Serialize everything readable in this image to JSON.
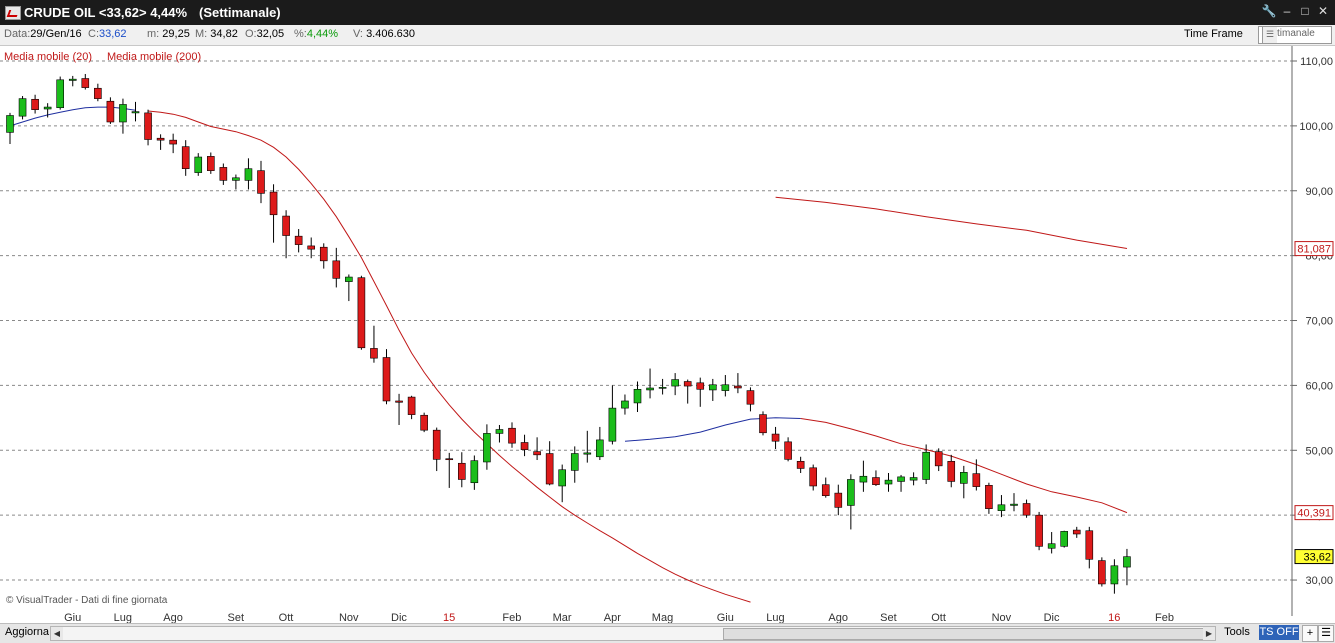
{
  "window": {
    "title": "CRUDE OIL <33,62> 4,44%",
    "timeframe_label": "(Settimanale)"
  },
  "infobar": {
    "date_label": "Data:",
    "date": "29/Gen/16",
    "close_label": "C:",
    "close": "33,62",
    "min_label": "m:",
    "min": "29,25",
    "max_label": "M:",
    "max": "34,82",
    "open_label": "O:",
    "open": "32,05",
    "pct_label": "%:",
    "pct": "4,44%",
    "vol_label": "V:",
    "vol": "3.406.630",
    "timeframe_label": "Time Frame",
    "timeframe_value": "Settimanale"
  },
  "colors": {
    "up": "#1bbd1b",
    "down": "#dd1a1a",
    "ma20": "#1f2fa0",
    "ma200": "#c01818",
    "grid": "#8a8a8a",
    "tag_bg": "#ffff33"
  },
  "footer": {
    "watermark": "© VisualTrader - Dati di fine giornata",
    "aggiorna": "Aggiorna",
    "tools": "Tools",
    "ts": "TS OFF",
    "plus": "+"
  },
  "chart_data": {
    "type": "candlestick",
    "legend": [
      "Media mobile (20)",
      "Media mobile (200)"
    ],
    "ylim": [
      26,
      110
    ],
    "yticks": [
      {
        "v": 110,
        "label": "110,00"
      },
      {
        "v": 100,
        "label": "100,00"
      },
      {
        "v": 90,
        "label": "90,00"
      },
      {
        "v": 80,
        "label": "80,00"
      },
      {
        "v": 70,
        "label": "70,00"
      },
      {
        "v": 60,
        "label": "60,00"
      },
      {
        "v": 50,
        "label": "50,00"
      },
      {
        "v": 40,
        "label": "40,00"
      },
      {
        "v": 30,
        "label": "30,00"
      }
    ],
    "xticks": [
      {
        "i": 3,
        "label": "Giu"
      },
      {
        "i": 7,
        "label": "Lug"
      },
      {
        "i": 11,
        "label": "Ago"
      },
      {
        "i": 16,
        "label": "Set"
      },
      {
        "i": 20,
        "label": "Ott"
      },
      {
        "i": 25,
        "label": "Nov"
      },
      {
        "i": 29,
        "label": "Dic"
      },
      {
        "i": 33,
        "label": "15",
        "highlight": true
      },
      {
        "i": 38,
        "label": "Feb"
      },
      {
        "i": 42,
        "label": "Mar"
      },
      {
        "i": 46,
        "label": "Apr"
      },
      {
        "i": 50,
        "label": "Mag"
      },
      {
        "i": 55,
        "label": "Giu"
      },
      {
        "i": 59,
        "label": "Lug"
      },
      {
        "i": 64,
        "label": "Ago"
      },
      {
        "i": 68,
        "label": "Set"
      },
      {
        "i": 72,
        "label": "Ott"
      },
      {
        "i": 77,
        "label": "Nov"
      },
      {
        "i": 81,
        "label": "Dic"
      },
      {
        "i": 86,
        "label": "16",
        "highlight": true
      },
      {
        "i": 90,
        "label": "Feb"
      }
    ],
    "price_tags": [
      {
        "v": 81.087,
        "label": "81,087",
        "style": "ma200"
      },
      {
        "v": 40.391,
        "label": "40,391",
        "style": "ma200"
      },
      {
        "v": 33.62,
        "label": "33,62",
        "style": "last"
      }
    ],
    "candles": [
      [
        99.0,
        102.0,
        97.2,
        101.6
      ],
      [
        101.5,
        104.6,
        101.0,
        104.2
      ],
      [
        104.1,
        104.8,
        101.9,
        102.5
      ],
      [
        102.6,
        103.5,
        101.3,
        102.9
      ],
      [
        102.8,
        107.6,
        102.5,
        107.1
      ],
      [
        107.0,
        107.7,
        106.1,
        107.2
      ],
      [
        107.3,
        108.0,
        105.6,
        105.9
      ],
      [
        105.8,
        106.5,
        103.8,
        104.2
      ],
      [
        103.8,
        104.4,
        100.3,
        100.6
      ],
      [
        100.6,
        104.2,
        98.8,
        103.3
      ],
      [
        102.0,
        103.7,
        100.7,
        102.2
      ],
      [
        102.0,
        102.5,
        97.0,
        97.9
      ],
      [
        98.1,
        98.7,
        96.3,
        97.8
      ],
      [
        97.8,
        98.8,
        95.8,
        97.2
      ],
      [
        96.8,
        97.8,
        92.3,
        93.4
      ],
      [
        92.8,
        95.8,
        92.3,
        95.2
      ],
      [
        95.3,
        95.9,
        92.6,
        93.1
      ],
      [
        93.6,
        94.2,
        90.9,
        91.6
      ],
      [
        91.6,
        92.5,
        90.2,
        92.0
      ],
      [
        91.6,
        95.0,
        90.2,
        93.4
      ],
      [
        93.1,
        94.6,
        88.1,
        89.6
      ],
      [
        89.8,
        91.0,
        82.0,
        86.3
      ],
      [
        86.1,
        87.0,
        79.6,
        83.1
      ],
      [
        83.0,
        84.1,
        80.5,
        81.7
      ],
      [
        81.5,
        82.8,
        79.6,
        81.0
      ],
      [
        81.3,
        81.9,
        78.0,
        79.2
      ],
      [
        79.2,
        81.2,
        75.1,
        76.5
      ],
      [
        76.0,
        77.1,
        73.0,
        76.7
      ],
      [
        76.6,
        76.9,
        65.5,
        65.8
      ],
      [
        65.7,
        69.2,
        63.5,
        64.2
      ],
      [
        64.3,
        65.6,
        57.1,
        57.6
      ],
      [
        57.6,
        58.7,
        53.9,
        57.4
      ],
      [
        58.2,
        58.4,
        54.8,
        55.5
      ],
      [
        55.4,
        55.8,
        52.8,
        53.1
      ],
      [
        53.1,
        53.5,
        46.8,
        48.6
      ],
      [
        48.7,
        49.6,
        44.2,
        48.6
      ],
      [
        48.0,
        49.7,
        44.3,
        45.5
      ],
      [
        45.0,
        49.2,
        43.9,
        48.4
      ],
      [
        48.2,
        54.0,
        47.0,
        52.6
      ],
      [
        52.6,
        53.9,
        51.2,
        53.2
      ],
      [
        53.4,
        54.3,
        50.4,
        51.1
      ],
      [
        51.2,
        52.4,
        49.1,
        50.1
      ],
      [
        49.8,
        52.0,
        48.5,
        49.3
      ],
      [
        49.5,
        51.4,
        44.6,
        44.8
      ],
      [
        44.5,
        47.8,
        42.0,
        47.0
      ],
      [
        46.9,
        50.6,
        45.0,
        49.5
      ],
      [
        49.4,
        53.0,
        48.1,
        49.6
      ],
      [
        49.0,
        53.6,
        48.5,
        51.6
      ],
      [
        51.4,
        60.0,
        50.9,
        56.5
      ],
      [
        56.5,
        58.6,
        55.5,
        57.6
      ],
      [
        57.3,
        60.6,
        55.9,
        59.4
      ],
      [
        59.3,
        62.6,
        58.0,
        59.6
      ],
      [
        59.7,
        61.0,
        58.6,
        59.7
      ],
      [
        59.9,
        61.9,
        58.5,
        60.9
      ],
      [
        60.6,
        60.9,
        57.2,
        59.9
      ],
      [
        60.4,
        61.2,
        56.7,
        59.4
      ],
      [
        59.3,
        61.0,
        57.6,
        60.1
      ],
      [
        59.2,
        61.6,
        58.3,
        60.1
      ],
      [
        59.9,
        61.9,
        58.8,
        59.6
      ],
      [
        59.2,
        59.7,
        56.0,
        57.1
      ],
      [
        55.5,
        56.0,
        52.3,
        52.7
      ],
      [
        52.5,
        53.6,
        50.2,
        51.4
      ],
      [
        51.3,
        52.0,
        48.3,
        48.6
      ],
      [
        48.3,
        49.0,
        46.5,
        47.2
      ],
      [
        47.3,
        47.8,
        43.8,
        44.5
      ],
      [
        44.7,
        45.8,
        42.7,
        43.0
      ],
      [
        43.4,
        44.7,
        40.0,
        41.2
      ],
      [
        41.5,
        46.3,
        37.8,
        45.5
      ],
      [
        45.1,
        48.4,
        43.6,
        46.0
      ],
      [
        45.8,
        46.9,
        44.5,
        44.7
      ],
      [
        44.8,
        46.5,
        43.6,
        45.4
      ],
      [
        45.2,
        46.2,
        43.6,
        45.9
      ],
      [
        45.4,
        46.6,
        44.6,
        45.8
      ],
      [
        45.5,
        50.9,
        44.8,
        49.7
      ],
      [
        49.8,
        50.3,
        46.8,
        47.6
      ],
      [
        48.3,
        49.3,
        44.3,
        45.2
      ],
      [
        44.9,
        47.6,
        42.6,
        46.6
      ],
      [
        46.4,
        48.6,
        43.8,
        44.4
      ],
      [
        44.6,
        45.0,
        40.2,
        41.0
      ],
      [
        40.7,
        43.1,
        39.7,
        41.6
      ],
      [
        41.5,
        43.4,
        40.6,
        41.7
      ],
      [
        41.8,
        42.4,
        39.6,
        40.0
      ],
      [
        40.0,
        40.5,
        34.6,
        35.2
      ],
      [
        34.9,
        37.4,
        34.1,
        35.6
      ],
      [
        35.2,
        37.6,
        35.0,
        37.5
      ],
      [
        37.7,
        38.2,
        36.5,
        37.1
      ],
      [
        37.6,
        38.2,
        31.8,
        33.2
      ],
      [
        33.0,
        33.5,
        29.0,
        29.4
      ],
      [
        29.4,
        33.2,
        27.9,
        32.2
      ],
      [
        32.0,
        34.8,
        29.2,
        33.6
      ]
    ],
    "ma20": [
      [
        0,
        100.0
      ],
      [
        1,
        100.6
      ],
      [
        2,
        101.2
      ],
      [
        3,
        101.7
      ],
      [
        4,
        102.1
      ],
      [
        5,
        102.5
      ],
      [
        6,
        102.8
      ],
      [
        7,
        102.9
      ],
      [
        8,
        102.9
      ],
      [
        9,
        102.7
      ],
      [
        10,
        102.4
      ],
      [
        49,
        51.4
      ],
      [
        51,
        51.7
      ],
      [
        53,
        52.1
      ],
      [
        55,
        52.8
      ],
      [
        57,
        53.9
      ],
      [
        59,
        54.8
      ],
      [
        61,
        55.0
      ],
      [
        63,
        54.9
      ]
    ],
    "ma200": [
      [
        11,
        102.3
      ],
      [
        12,
        102.1
      ],
      [
        13,
        101.8
      ],
      [
        14,
        101.3
      ],
      [
        15,
        100.6
      ],
      [
        16,
        99.9
      ],
      [
        17,
        99.5
      ],
      [
        18,
        99.1
      ],
      [
        19,
        98.5
      ],
      [
        20,
        97.8
      ],
      [
        21,
        96.7
      ],
      [
        22,
        95.2
      ],
      [
        23,
        93.3
      ],
      [
        24,
        91.1
      ],
      [
        25,
        88.7
      ],
      [
        26,
        86.0
      ],
      [
        27,
        82.9
      ],
      [
        28,
        79.7
      ],
      [
        29,
        76.0
      ],
      [
        30,
        72.3
      ],
      [
        31,
        68.5
      ],
      [
        32,
        65.0
      ],
      [
        33,
        62.0
      ],
      [
        34,
        59.4
      ],
      [
        35,
        57.0
      ],
      [
        36,
        54.8
      ],
      [
        37,
        52.8
      ],
      [
        38,
        51.0
      ],
      [
        39,
        49.2
      ],
      [
        40,
        47.5
      ],
      [
        41,
        45.9
      ],
      [
        42,
        44.3
      ],
      [
        43,
        42.8
      ],
      [
        44,
        41.3
      ],
      [
        45,
        40.0
      ],
      [
        46,
        38.8
      ],
      [
        47,
        37.6
      ],
      [
        48,
        36.5
      ],
      [
        49,
        35.3
      ],
      [
        50,
        34.1
      ],
      [
        51,
        33.0
      ],
      [
        52,
        31.9
      ],
      [
        53,
        30.9
      ],
      [
        54,
        30.0
      ],
      [
        55,
        29.2
      ],
      [
        56,
        28.5
      ],
      [
        57,
        27.8
      ],
      [
        58,
        27.2
      ],
      [
        59,
        26.6
      ]
    ],
    "ma200_b": [
      [
        61,
        89.0
      ],
      [
        65,
        88.2
      ],
      [
        69,
        87.2
      ],
      [
        73,
        86.0
      ],
      [
        77,
        84.9
      ],
      [
        81,
        83.9
      ],
      [
        85,
        82.4
      ],
      [
        89,
        81.1
      ]
    ],
    "ma200_c": [
      [
        63,
        54.9
      ],
      [
        65,
        54.3
      ],
      [
        67,
        53.3
      ],
      [
        69,
        52.2
      ],
      [
        71,
        51.0
      ],
      [
        73,
        50.1
      ],
      [
        75,
        49.1
      ],
      [
        77,
        47.8
      ],
      [
        79,
        46.3
      ],
      [
        81,
        44.8
      ],
      [
        83,
        43.6
      ],
      [
        85,
        42.8
      ],
      [
        87,
        41.9
      ],
      [
        89,
        40.4
      ]
    ]
  }
}
